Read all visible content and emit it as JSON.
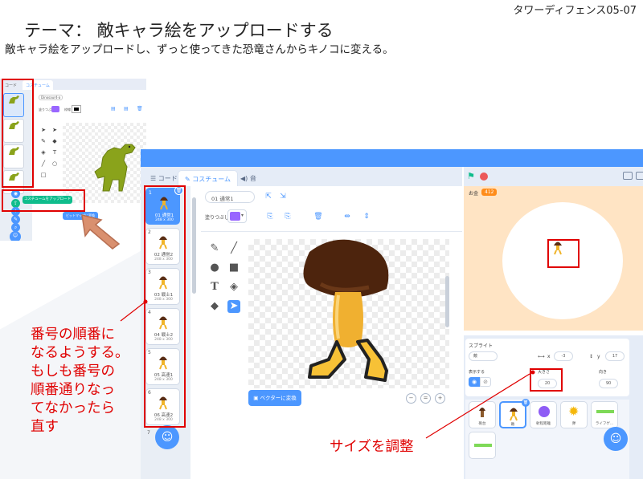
{
  "slide": {
    "title": "テーマ： 敵キャラ絵をアップロードする",
    "code": "タワーディフェンス05-07",
    "subtitle": "敵キャラ絵をアップロードし、ずっと使ってきた恐竜さんからキノコに変える。"
  },
  "small_screenshot": {
    "tab_code": "コード",
    "tab_costumes": "コスチューム",
    "costume_name": "Dinosaur4-a",
    "fill_label": "塗りつぶし",
    "outline_label": "枠線",
    "upload_label": "コスチュームをアップロード",
    "vector_label": "ビットマップに変換"
  },
  "editor": {
    "tab_code": "コード",
    "tab_costumes": "コスチューム",
    "tab_sounds": "音",
    "costume_name": "01 通常1",
    "fill_label": "塗りつぶし",
    "convert_button": "ベクターに変換",
    "costumes": [
      {
        "num": "1",
        "name": "01 通常1",
        "size": "248 x 300"
      },
      {
        "num": "2",
        "name": "02 通常2",
        "size": "248 x 300"
      },
      {
        "num": "3",
        "name": "03 戦士1",
        "size": "248 x 300"
      },
      {
        "num": "4",
        "name": "04 戦士2",
        "size": "248 x 300"
      },
      {
        "num": "5",
        "name": "05 高速1",
        "size": "248 x 300"
      },
      {
        "num": "6",
        "name": "06 高速2",
        "size": "248 x 300"
      },
      {
        "num": "7",
        "name": "",
        "size": ""
      }
    ]
  },
  "stage": {
    "money_label": "お金",
    "money_value": "412"
  },
  "sprite_info": {
    "sprite_label": "スプライト",
    "sprite_name": "敵",
    "x_label": "x",
    "x_value": "-3",
    "y_label": "y",
    "y_value": "17",
    "show_label": "表示する",
    "size_label": "大きさ",
    "size_value": "20",
    "direction_label": "向き",
    "direction_value": "90",
    "sprites": [
      "砲台",
      "敵",
      "射程距離",
      "弾",
      "ライフゲ..."
    ]
  },
  "annotations": {
    "order_note": [
      "番号の順番に",
      "なるようする。",
      "もしも番号の",
      "順番通りなっ",
      "てなかったら",
      "直す"
    ],
    "size_note": "サイズを調整"
  },
  "colors": {
    "annotation_red": "#e00000",
    "scratch_blue": "#4c97ff",
    "stage_bg": "#ffe4c4"
  }
}
